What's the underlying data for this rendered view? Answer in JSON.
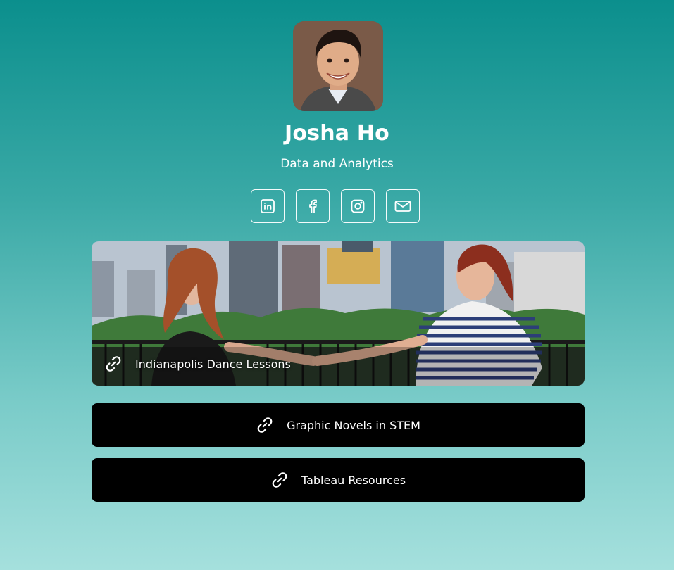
{
  "profile": {
    "name": "Josha Ho",
    "tagline": "Data and Analytics",
    "avatar_alt": "profile-photo"
  },
  "socials": [
    {
      "icon": "linkedin-icon"
    },
    {
      "icon": "facebook-icon"
    },
    {
      "icon": "instagram-icon"
    },
    {
      "icon": "email-icon"
    }
  ],
  "links": {
    "featured": {
      "label": "Indianapolis Dance Lessons",
      "icon": "link-icon"
    },
    "items": [
      {
        "label": "Graphic Novels in STEM",
        "icon": "link-icon"
      },
      {
        "label": "Tableau Resources",
        "icon": "link-icon"
      }
    ]
  },
  "colors": {
    "background_top": "#0b8f8d",
    "background_bottom": "#a5e0dd",
    "button": "#000000",
    "text": "#ffffff"
  }
}
